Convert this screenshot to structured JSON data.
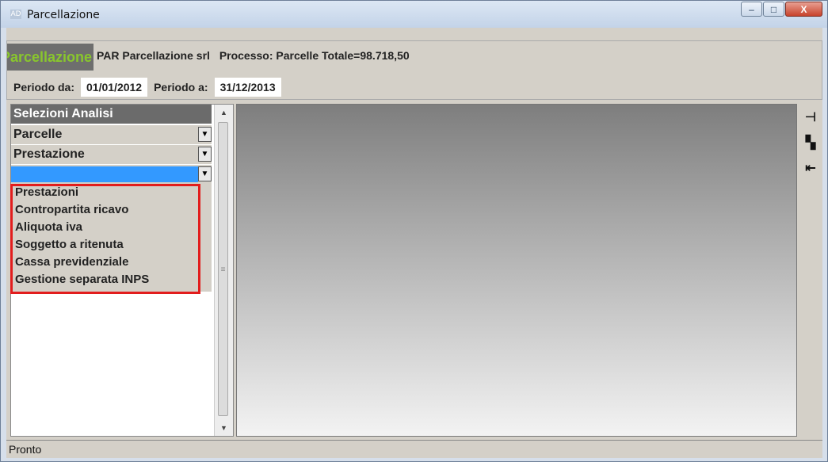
{
  "window": {
    "app_icon_text": "AD",
    "title": "Parcellazione",
    "min_label": "–",
    "max_label": "□",
    "close_label": "X"
  },
  "header": {
    "logo_text": "Parcellazione",
    "company": "PAR Parcellazione srl",
    "process": "Processo: Parcelle Totale=98.718,50",
    "period_from_label": "Periodo da:",
    "period_from": "01/01/2012",
    "period_to_label": "Periodo a:",
    "period_to": "31/12/2013"
  },
  "panel": {
    "title": "Selezioni Analisi",
    "dropdowns": [
      {
        "value": "Parcelle"
      },
      {
        "value": "Prestazione"
      },
      {
        "value": ""
      }
    ],
    "items": [
      "Prestazioni",
      "Contropartita ricavo",
      "Aliquota iva",
      "Soggetto a ritenuta",
      "Cassa previdenziale",
      "Gestione separata INPS"
    ]
  },
  "status": "Pronto",
  "icons": {
    "pin": "pin-icon",
    "swap": "swap-icon",
    "collapse": "collapse-left-icon"
  },
  "colors": {
    "highlight": "#e21d1d",
    "selected": "#3399ff",
    "logo_green": "#89c62d"
  }
}
